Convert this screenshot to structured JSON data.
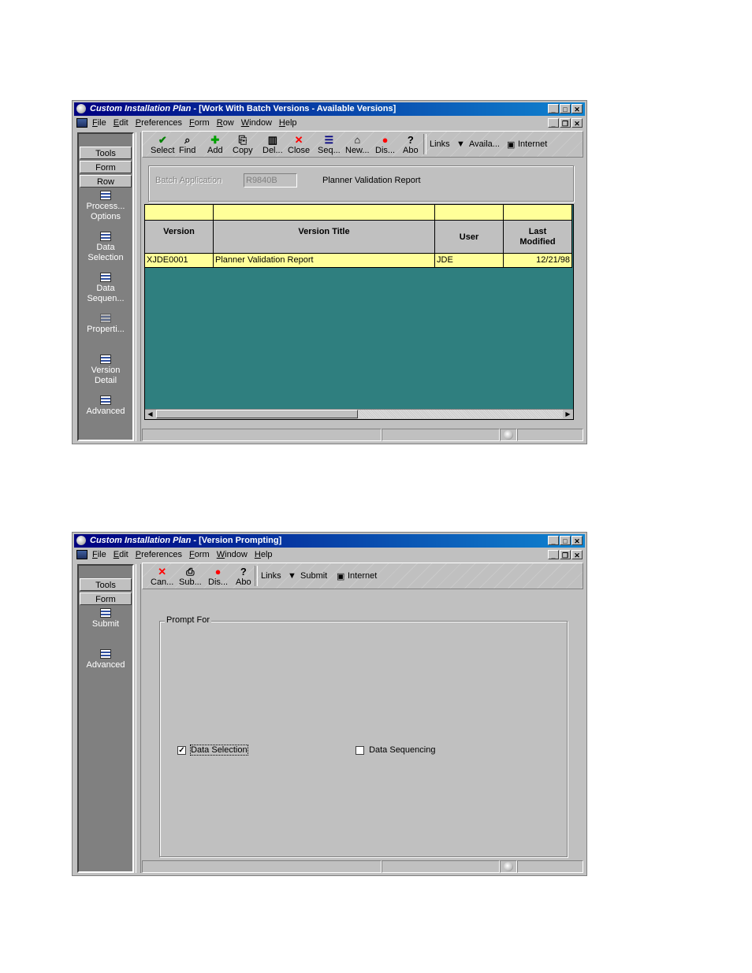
{
  "window1": {
    "title_app": "Custom Installation Plan",
    "title_rest": " - [Work With Batch Versions - Available Versions]",
    "menu": [
      "File",
      "Edit",
      "Preferences",
      "Form",
      "Row",
      "Window",
      "Help"
    ],
    "sidebar": {
      "buttons": [
        "Tools",
        "Form",
        "Row"
      ],
      "items": [
        {
          "line1": "Process...",
          "line2": "Options"
        },
        {
          "line1": "Data",
          "line2": "Selection"
        },
        {
          "line1": "Data",
          "line2": "Sequen..."
        },
        {
          "line1": "Properti...",
          "line2": ""
        },
        {
          "line1": "Version",
          "line2": "Detail"
        },
        {
          "line1": "Advanced",
          "line2": ""
        }
      ]
    },
    "toolbar": {
      "buttons": [
        {
          "label": "Select",
          "glyph": "✔",
          "color": "#008000"
        },
        {
          "label": "Find",
          "glyph": "🔍",
          "color": "#000000"
        },
        {
          "label": "Add",
          "glyph": "✚",
          "color": "#00a000"
        },
        {
          "label": "Copy",
          "glyph": "⎘",
          "color": "#000000"
        },
        {
          "label": "Del...",
          "glyph": "🗑",
          "color": "#000000"
        },
        {
          "label": "Close",
          "glyph": "✕",
          "color": "#ff0000"
        },
        {
          "label": "Seq...",
          "glyph": "☰",
          "color": "#000080"
        },
        {
          "label": "New...",
          "glyph": "⌂",
          "color": "#000000"
        },
        {
          "label": "Dis...",
          "glyph": "●",
          "color": "#ff0000"
        },
        {
          "label": "Abo",
          "glyph": "?",
          "color": "#000000"
        }
      ],
      "links": "Links",
      "available": "Availa...",
      "internet": "Internet"
    },
    "header": {
      "batch_app_label": "Batch Application",
      "batch_app_value": "R9840B",
      "batch_app_desc": "Planner Validation Report"
    },
    "grid": {
      "columns": [
        "Version",
        "Version Title",
        "User",
        "Last Modified"
      ],
      "rows": [
        {
          "version": "XJDE0001",
          "title": "Planner Validation Report",
          "user": "JDE",
          "modified": "12/21/98"
        }
      ]
    }
  },
  "window2": {
    "title_app": "Custom Installation Plan",
    "title_rest": " - [Version Prompting]",
    "menu": [
      "File",
      "Edit",
      "Preferences",
      "Form",
      "Window",
      "Help"
    ],
    "sidebar": {
      "buttons": [
        "Tools",
        "Form"
      ],
      "items": [
        {
          "line1": "Submit",
          "line2": ""
        },
        {
          "line1": "Advanced",
          "line2": ""
        }
      ]
    },
    "toolbar": {
      "buttons": [
        {
          "label": "Can...",
          "glyph": "✕",
          "color": "#ff0000"
        },
        {
          "label": "Sub...",
          "glyph": "⎙",
          "color": "#000000"
        },
        {
          "label": "Dis...",
          "glyph": "●",
          "color": "#ff0000"
        },
        {
          "label": "Abo",
          "glyph": "?",
          "color": "#000000"
        }
      ],
      "links": "Links",
      "submit": "Submit",
      "internet": "Internet"
    },
    "prompt_group": "Prompt For",
    "data_selection": {
      "label": "Data Selection",
      "checked": true
    },
    "data_sequencing": {
      "label": "Data Sequencing",
      "checked": false
    }
  }
}
